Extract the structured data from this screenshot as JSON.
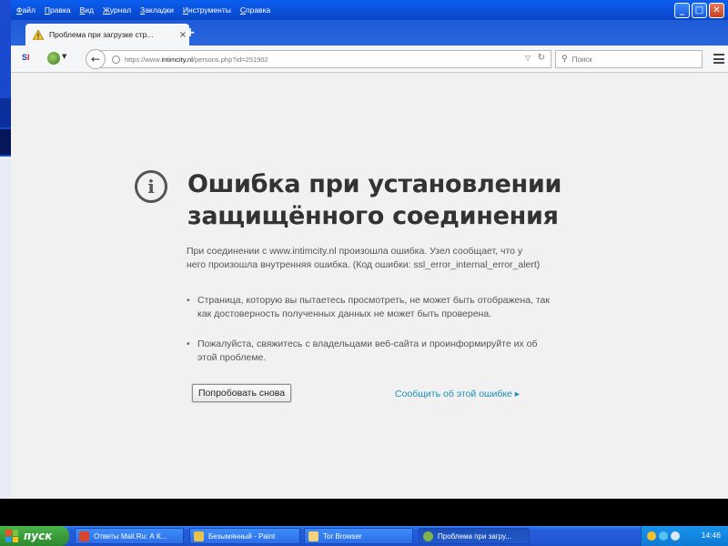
{
  "menubar": {
    "items": [
      "Файл",
      "Правка",
      "Вид",
      "Журнал",
      "Закладки",
      "Инструменты",
      "Справка"
    ]
  },
  "window_controls": {
    "minimize": "_",
    "maximize": "□",
    "close": "✕"
  },
  "tab": {
    "title": "Проблема при загрузке стр...",
    "close": "×",
    "new_tab": "+"
  },
  "navbar": {
    "logo_text": "S",
    "logo_accent": "I",
    "url_prefix": "https://www.",
    "url_domain": "intimcity.nl",
    "url_path": "/persons.php?id=251902",
    "search_placeholder": "Поиск"
  },
  "error_page": {
    "title": "Ошибка при установлении защищённого соединения",
    "description": "При соединении с www.intimcity.nl произошла ошибка. Узел сообщает, что у него произошла внутренняя ошибка. (Код ошибки: ssl_error_internal_error_alert)",
    "bullets": [
      "Страница, которую вы пытаетесь просмотреть, не может быть отображена, так как достоверность полученных данных не может быть проверена.",
      "Пожалуйста, свяжитесь с владельцами веб-сайта и проинформируйте их об этой проблеме."
    ],
    "retry_button": "Попробовать снова",
    "report_link": "Сообщить об этой ошибке ▸"
  },
  "taskbar": {
    "start_label": "пуск",
    "tasks": [
      {
        "label": "Ответы Mail.Ru: А К...",
        "icon_color": "#d9462b"
      },
      {
        "label": "Безымянный - Paint",
        "icon_color": "#e8c24a"
      },
      {
        "label": "Tor Browser",
        "icon_color": "#f3d27a"
      },
      {
        "label": "Проблема при загру...",
        "icon_color": "#7fb24a"
      }
    ],
    "clock": "14:46"
  }
}
